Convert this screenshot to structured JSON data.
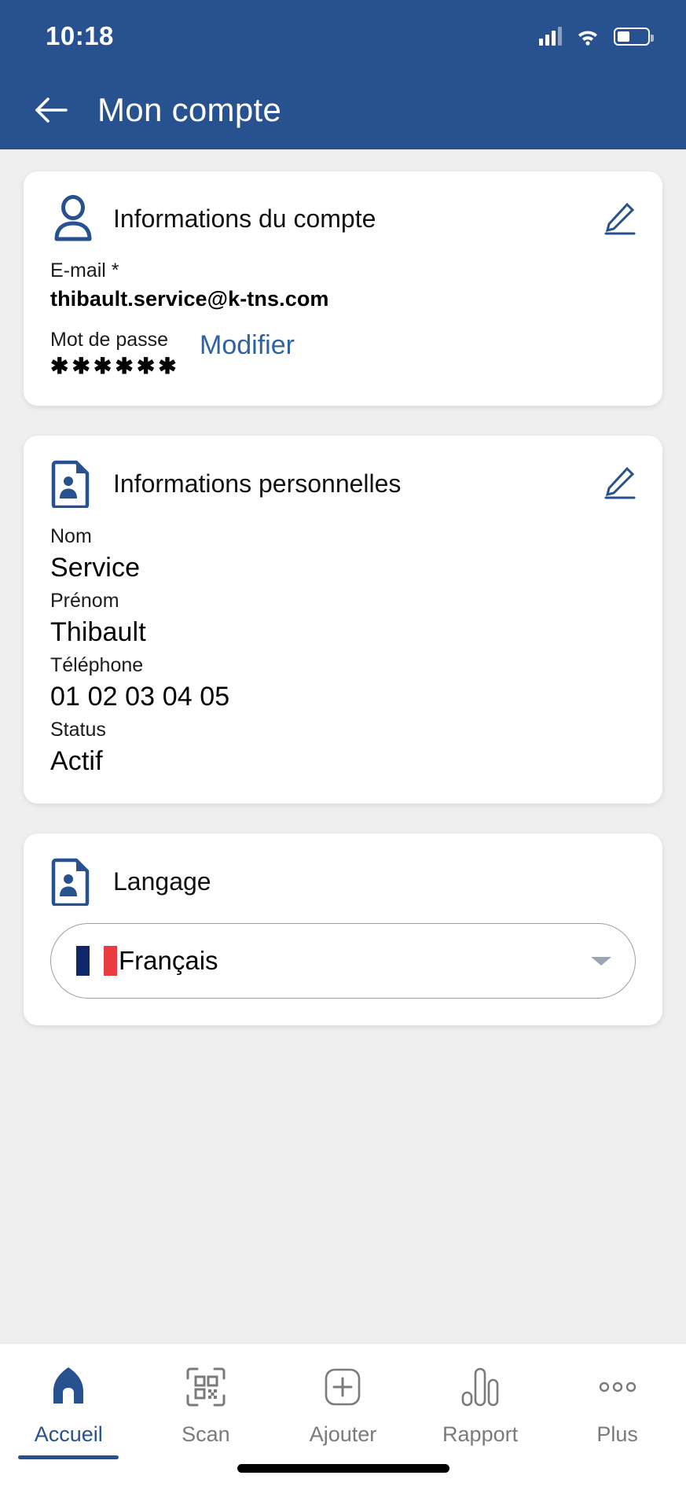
{
  "theme": {
    "header_blue": "#27528F",
    "accent_blue": "#2E62A4",
    "page_bg": "#EFEFEF",
    "card_bg": "#FFFFFF",
    "muted_text": "#7A7A7A"
  },
  "status_bar": {
    "time": "10:18",
    "signal_icon": "cellular-signal-icon",
    "wifi_icon": "wifi-icon",
    "battery_icon": "battery-icon"
  },
  "appbar": {
    "back_icon": "arrow-left-icon",
    "title": "Mon compte"
  },
  "cards": {
    "account": {
      "icon": "person-icon",
      "title": "Informations du compte",
      "edit_icon": "pencil-edit-icon",
      "email_label": "E-mail *",
      "email_value": "thibault.service@k-tns.com",
      "password_label": "Mot de passe",
      "password_value": "✱✱✱✱✱✱",
      "password_action": "Modifier"
    },
    "personal": {
      "icon": "id-card-icon",
      "title": "Informations personnelles",
      "edit_icon": "pencil-edit-icon",
      "fields": [
        {
          "label": "Nom",
          "value": "Service"
        },
        {
          "label": "Prénom",
          "value": "Thibault"
        },
        {
          "label": "Téléphone",
          "value": "01 02 03 04 05"
        },
        {
          "label": "Status",
          "value": "Actif"
        }
      ]
    },
    "language": {
      "icon": "id-card-icon",
      "title": "Langage",
      "selected": "Français",
      "flag_icon": "france-flag-icon",
      "chevron_icon": "chevron-down-icon"
    }
  },
  "bottom_nav": {
    "items": [
      {
        "label": "Accueil",
        "icon": "home-icon",
        "active": true
      },
      {
        "label": "Scan",
        "icon": "qr-scan-icon",
        "active": false
      },
      {
        "label": "Ajouter",
        "icon": "plus-square-icon",
        "active": false
      },
      {
        "label": "Rapport",
        "icon": "bar-chart-icon",
        "active": false
      },
      {
        "label": "Plus",
        "icon": "more-dots-icon",
        "active": false
      }
    ]
  }
}
